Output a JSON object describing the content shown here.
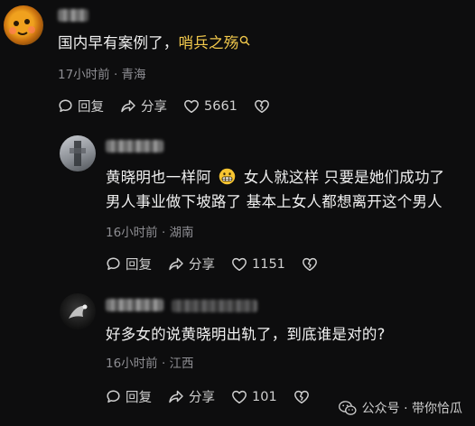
{
  "comments": [
    {
      "text_plain": "国内早有案例了，",
      "text_link": "哨兵之殇",
      "meta": "17小时前 · 青海",
      "reply_label": "回复",
      "share_label": "分享",
      "like_count": "5661"
    },
    {
      "line1a": "黄晓明也一样阿",
      "line1b": "女人就这样 只要是她们成功了",
      "line2": "男人事业做下坡路了 基本上女人都想离开这个男人",
      "meta": "16小时前 · 湖南",
      "reply_label": "回复",
      "share_label": "分享",
      "like_count": "1151"
    },
    {
      "text": "好多女的说黄晓明出轨了，到底谁是对的?",
      "meta": "16小时前 · 江西",
      "reply_label": "回复",
      "share_label": "分享",
      "like_count": "101"
    }
  ],
  "watermark": {
    "text": "公众号 · 带你恰瓜"
  },
  "colors": {
    "background": "#0d0d0e",
    "link": "#f2c94c",
    "meta": "#8e8e93"
  }
}
